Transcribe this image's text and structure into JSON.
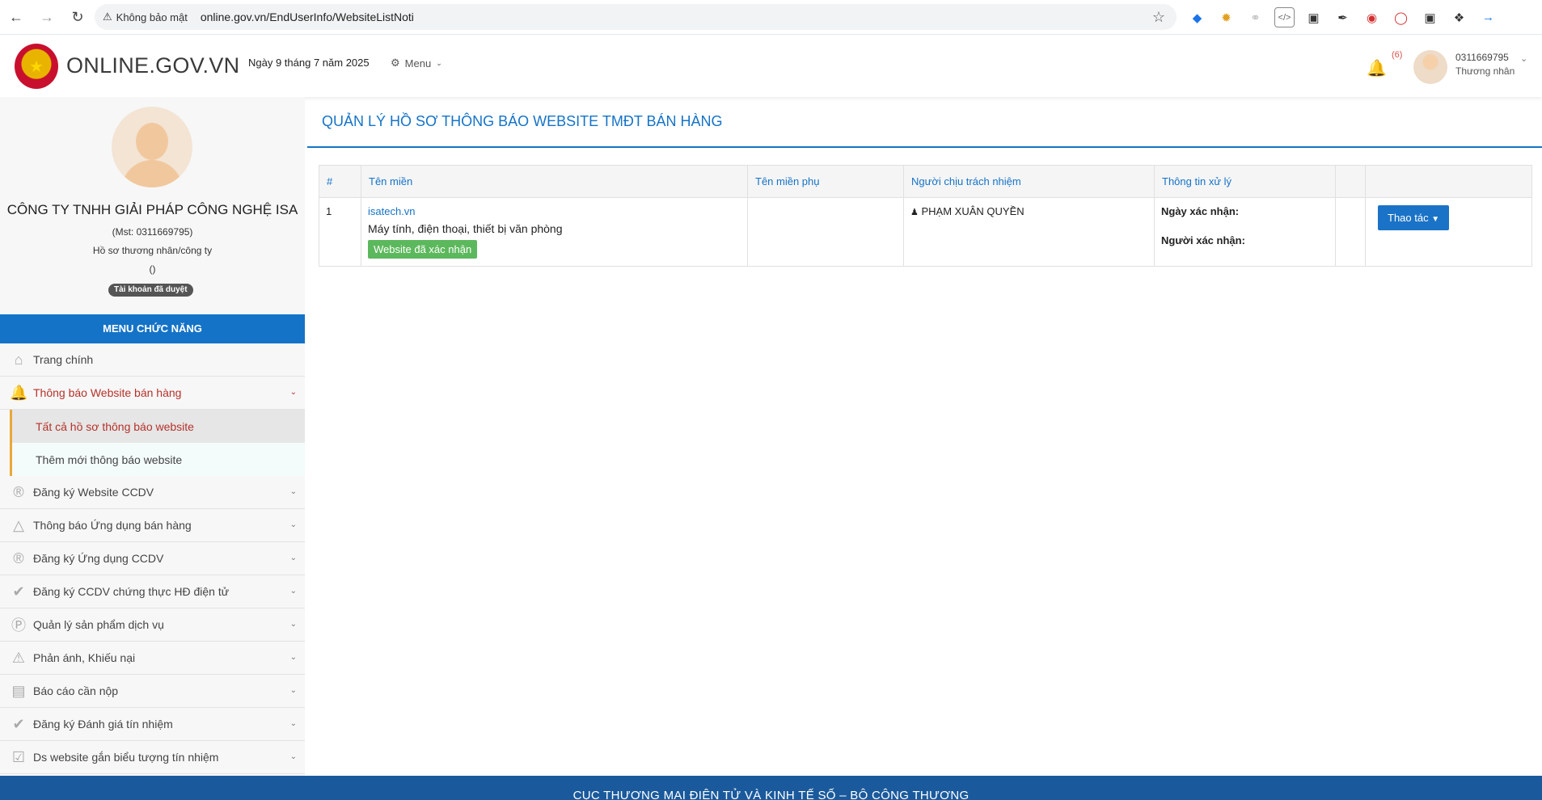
{
  "browser": {
    "security_label": "Không bảo mật",
    "url": "online.gov.vn/EndUserInfo/WebsiteListNoti"
  },
  "header": {
    "site_name": "ONLINE.GOV.VN",
    "date": "Ngày 9 tháng 7 năm 2025",
    "menu_label": "Menu",
    "notification_count": "(6)",
    "user_id": "0311669795",
    "user_role": "Thương nhân"
  },
  "profile": {
    "company": "CÔNG TY TNHH GIẢI PHÁP CÔNG NGHỆ ISA",
    "mst": "(Mst: 0311669795)",
    "profile_type": "Hồ sơ thương nhân/công ty",
    "extra": "()",
    "status_badge": "Tài khoản đã duyệt"
  },
  "sidebar": {
    "menu_title": "MENU CHỨC NĂNG",
    "items": [
      {
        "label": "Trang chính",
        "icon": "home-icon"
      },
      {
        "label": "Thông báo Website bán hàng",
        "icon": "bell-icon"
      },
      {
        "label": "Tất cả hồ sơ thông báo website"
      },
      {
        "label": "Thêm mới thông báo website"
      },
      {
        "label": "Đăng ký Website CCDV",
        "icon": "registered-icon"
      },
      {
        "label": "Thông báo Ứng dụng bán hàng",
        "icon": "bell-icon"
      },
      {
        "label": "Đăng ký Ứng dụng CCDV",
        "icon": "registered-icon"
      },
      {
        "label": "Đăng ký CCDV chứng thực HĐ điện tử",
        "icon": "check-circle-icon"
      },
      {
        "label": "Quản lý sản phẩm dịch vụ",
        "icon": "p-circle-icon"
      },
      {
        "label": "Phản ánh, Khiếu nại",
        "icon": "warning-icon"
      },
      {
        "label": "Báo cáo cần nộp",
        "icon": "document-icon"
      },
      {
        "label": "Đăng ký Đánh giá tín nhiệm",
        "icon": "check-circle-icon"
      },
      {
        "label": "Ds website gắn biểu tượng tín nhiệm",
        "icon": "checkbox-icon"
      }
    ]
  },
  "main": {
    "title": "QUẢN LÝ HỒ SƠ THÔNG BÁO WEBSITE TMĐT BÁN HÀNG",
    "table": {
      "headers": [
        "#",
        "Tên miền",
        "Tên miền phụ",
        "Người chịu trách nhiệm",
        "Thông tin xử lý",
        "",
        ""
      ],
      "rows": [
        {
          "index": "1",
          "domain": "isatech.vn",
          "description": "Máy tính, điện thoại, thiết bị văn phòng",
          "status": "Website đã xác nhận",
          "subdomain": "",
          "person": "PHẠM XUÂN QUYỀN",
          "confirm_date_label": "Ngày xác nhận:",
          "confirmer_label": "Người xác nhận:",
          "action_label": "Thao tác"
        }
      ]
    }
  },
  "footer": {
    "text": "CỤC THƯƠNG MẠI ĐIỆN TỬ VÀ KINH TẾ SỐ – BỘ CÔNG THƯƠNG"
  },
  "colors": {
    "primary_blue": "#1573c7",
    "active_red": "#b5322a",
    "success_green": "#5cb85c",
    "footer_blue": "#1a5a9c"
  }
}
